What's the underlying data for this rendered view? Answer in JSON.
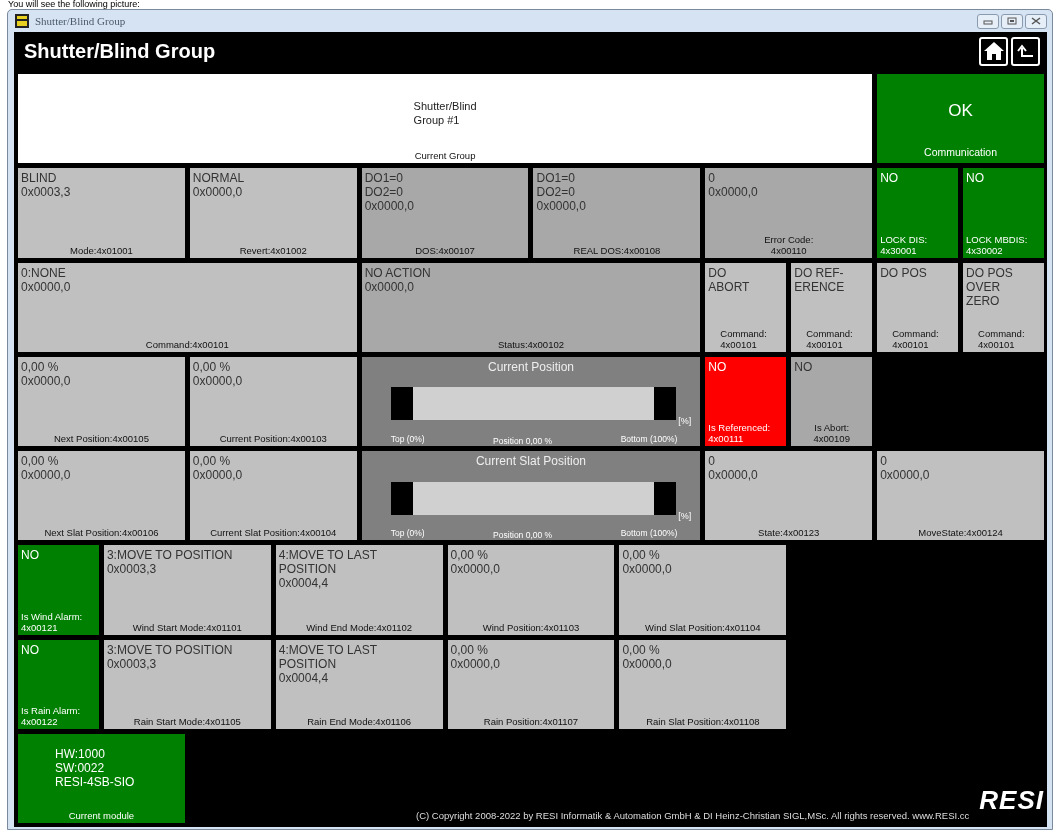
{
  "caption": "You will see the following picture:",
  "window": {
    "title": "Shutter/Blind Group"
  },
  "header": {
    "title": "Shutter/Blind Group"
  },
  "rows": [
    [
      {
        "kind": "group",
        "value": "Shutter/Blind\nGroup #1",
        "label": "Current Group",
        "color": "#ffffff"
      },
      {
        "kind": "status",
        "value": "OK",
        "label": "Communication",
        "color": "#008000"
      }
    ],
    [
      {
        "kind": "register",
        "value": "BLIND",
        "raw": "0x0003,3",
        "label": "Mode:4x01001",
        "color": "#c0c0c0"
      },
      {
        "kind": "register",
        "value": "NORMAL",
        "raw": "0x0000,0",
        "label": "Revert:4x01002",
        "color": "#c0c0c0"
      },
      {
        "kind": "register",
        "value": "DO1=0\nDO2=0",
        "raw": "0x0000,0",
        "label": "DOS:4x00107",
        "color": "#a8a8a8"
      },
      {
        "kind": "register",
        "value": "DO1=0\nDO2=0",
        "raw": "0x0000,0",
        "label": "REAL DOS:4x00108",
        "color": "#a8a8a8"
      },
      {
        "kind": "register",
        "value": "0",
        "raw": "0x0000,0",
        "label": "Error Code:\n4x00110",
        "color": "#a8a8a8"
      },
      {
        "kind": "flag",
        "value": "NO",
        "label": "LOCK DIS:\n4x30001",
        "color": "#008000"
      },
      {
        "kind": "flag",
        "value": "NO",
        "label": "LOCK MBDIS:\n4x30002",
        "color": "#008000"
      }
    ],
    [
      {
        "kind": "register",
        "value": "0:NONE",
        "raw": "0x0000,0",
        "label": "Command:4x00101",
        "color": "#c0c0c0"
      },
      {
        "kind": "register",
        "value": "NO ACTION",
        "raw": "0x0000,0",
        "label": "Status:4x00102",
        "color": "#a8a8a8"
      },
      {
        "kind": "command",
        "value": "DO\nABORT",
        "label": "Command:\n4x00101",
        "color": "#c0c0c0"
      },
      {
        "kind": "command",
        "value": "DO REF-\nERENCE",
        "label": "Command:\n4x00101",
        "color": "#c0c0c0"
      },
      {
        "kind": "command",
        "value": "DO POS",
        "label": "Command:\n4x00101",
        "color": "#c0c0c0"
      },
      {
        "kind": "command",
        "value": "DO POS\nOVER\nZERO",
        "label": "Command:\n4x00101",
        "color": "#c0c0c0"
      }
    ],
    [
      {
        "kind": "register",
        "value": "0,00 %",
        "raw": "0x0000,0",
        "label": "Next Position:4x00105",
        "color": "#c0c0c0"
      },
      {
        "kind": "register",
        "value": "0,00 %",
        "raw": "0x0000,0",
        "label": "Current Position:4x00103",
        "color": "#c0c0c0"
      },
      {
        "kind": "bar",
        "title": "Current Position",
        "level": 0,
        "left": "Top (0%)",
        "right": "Bottom (100%)",
        "unit": "[%]",
        "reading": "Position 0,00 %",
        "color": "#808080"
      },
      {
        "kind": "flag",
        "value": "NO",
        "label": "Is Referenced:\n4x00111",
        "color": "#ff0000"
      },
      {
        "kind": "flag",
        "value": "NO",
        "label": "Is Abort:\n4x00109",
        "color": "#a8a8a8"
      }
    ],
    [
      {
        "kind": "register",
        "value": "0,00 %",
        "raw": "0x0000,0",
        "label": "Next Slat Position:4x00106",
        "color": "#c0c0c0"
      },
      {
        "kind": "register",
        "value": "0,00 %",
        "raw": "0x0000,0",
        "label": "Current Slat Position:4x00104",
        "color": "#c0c0c0"
      },
      {
        "kind": "bar",
        "title": "Current Slat Position",
        "level": 0,
        "left": "Top (0%)",
        "right": "Bottom (100%)",
        "unit": "[%]",
        "reading": "Position 0,00 %",
        "color": "#808080"
      },
      {
        "kind": "register",
        "value": "0",
        "raw": "0x0000,0",
        "label": "State:4x00123",
        "color": "#c0c0c0"
      },
      {
        "kind": "register",
        "value": "0",
        "raw": "0x0000,0",
        "label": "MoveState:4x00124",
        "color": "#c0c0c0"
      }
    ],
    [
      {
        "kind": "flag",
        "value": "NO",
        "label": "Is Wind Alarm:\n4x00121",
        "color": "#008000"
      },
      {
        "kind": "register",
        "value": "3:MOVE TO POSITION",
        "raw": "0x0003,3",
        "label": "Wind Start Mode:4x01101",
        "color": "#c0c0c0"
      },
      {
        "kind": "register",
        "value": "4:MOVE TO LAST\nPOSITION",
        "raw": "0x0004,4",
        "label": "Wind End Mode:4x01102",
        "color": "#c0c0c0"
      },
      {
        "kind": "register",
        "value": "0,00 %",
        "raw": "0x0000,0",
        "label": "Wind Position:4x01103",
        "color": "#c0c0c0"
      },
      {
        "kind": "register",
        "value": "0,00 %",
        "raw": "0x0000,0",
        "label": "Wind Slat Position:4x01104",
        "color": "#c0c0c0"
      }
    ],
    [
      {
        "kind": "flag",
        "value": "NO",
        "label": "Is Rain Alarm:\n4x00122",
        "color": "#008000"
      },
      {
        "kind": "register",
        "value": "3:MOVE TO POSITION",
        "raw": "0x0003,3",
        "label": "Rain Start Mode:4x01105",
        "color": "#c0c0c0"
      },
      {
        "kind": "register",
        "value": "4:MOVE TO LAST\nPOSITION",
        "raw": "0x0004,4",
        "label": "Rain End Mode:4x01106",
        "color": "#c0c0c0"
      },
      {
        "kind": "register",
        "value": "0,00 %",
        "raw": "0x0000,0",
        "label": "Rain Position:4x01107",
        "color": "#c0c0c0"
      },
      {
        "kind": "register",
        "value": "0,00 %",
        "raw": "0x0000,0",
        "label": "Rain Slat Position:4x01108",
        "color": "#c0c0c0"
      }
    ]
  ],
  "module": {
    "value": "HW:1000\nSW:0022\nRESI-4SB-SIO",
    "label": "Current module",
    "color": "#008000"
  },
  "footer": {
    "copyright": "(C) Copyright 2008-2022 by RESI Informatik & Automation GmbH & DI Heinz-Christian SIGL,MSc. All rights reserved. www.RESI.cc",
    "logo": "RESI"
  }
}
